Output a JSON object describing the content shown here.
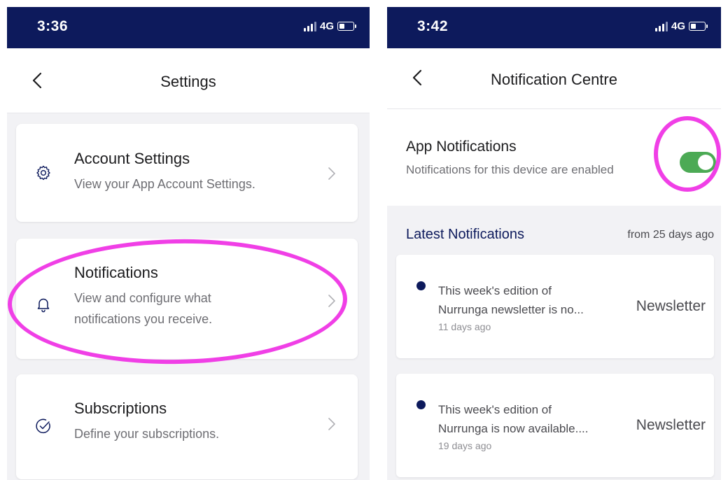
{
  "left_screen": {
    "status_bar": {
      "time": "3:36",
      "network": "4G"
    },
    "header": {
      "title": "Settings"
    },
    "items": [
      {
        "title": "Account Settings",
        "description": [
          "View your App Account Settings."
        ],
        "icon": "gear-icon"
      },
      {
        "title": "Notifications",
        "description": [
          "View and configure what",
          "notifications you receive."
        ],
        "icon": "bell-icon"
      },
      {
        "title": "Subscriptions",
        "description": [
          "Define your subscriptions."
        ],
        "icon": "check-circle-icon"
      }
    ]
  },
  "right_screen": {
    "status_bar": {
      "time": "3:42",
      "network": "4G"
    },
    "header": {
      "title": "Notification Centre"
    },
    "app_notifications": {
      "title": "App Notifications",
      "description": "Notifications for this device are enabled",
      "enabled": true
    },
    "latest": {
      "title": "Latest Notifications",
      "meta": "from 25 days ago",
      "items": [
        {
          "lines": [
            "This week's edition of",
            "Nurrunga newsletter is no..."
          ],
          "time": "11 days ago",
          "category": "Newsletter"
        },
        {
          "lines": [
            "This week's edition of",
            "Nurrunga is now available...."
          ],
          "time": "19 days ago",
          "category": "Newsletter"
        }
      ]
    }
  },
  "colors": {
    "status_bar": "#0d1a5c",
    "toggle_on": "#4caa55",
    "highlight": "#f03fe6",
    "accent_text": "#0d1a5c"
  }
}
